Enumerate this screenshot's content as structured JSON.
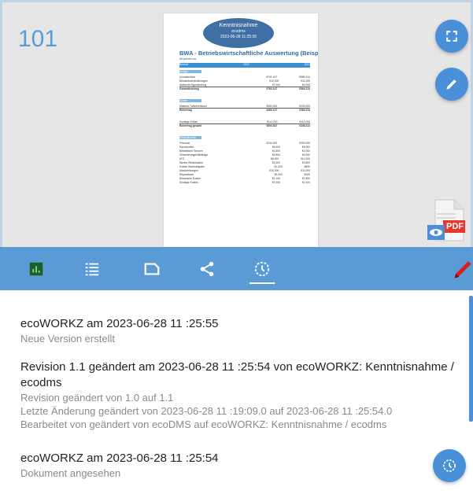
{
  "document": {
    "number": "101",
    "stamp": {
      "line1": "Kenntnisnahme",
      "line2": "ecodms",
      "line3": "2023-06-28 11:25:56"
    },
    "title": "BWA - Betriebswirtschaftliche Auswertung (Beispiel)",
    "subtitle": "Musterfirma",
    "header_row": {
      "label": "Bereich",
      "col1": "2022",
      "col2": "2021"
    },
    "rows": [
      {
        "label": "Erträge",
        "kind": "section"
      },
      {
        "label": "Umsatzerlöse",
        "v1": "€741.147",
        "v2": "€580.214",
        "kind": "row"
      },
      {
        "label": "Bestandsveränderungen",
        "v1": "€12.000",
        "v2": "€11.000",
        "kind": "row"
      },
      {
        "label": "Aktivierte Eigenleistung",
        "v1": "€7.000",
        "v2": "€4.000",
        "kind": "row"
      },
      {
        "label": "Gesamtleistung",
        "v1": "€760.147",
        "v2": "€594.214",
        "kind": "bold"
      },
      {
        "label": "Kosten",
        "kind": "section"
      },
      {
        "label": "Material / Wareneinkauf",
        "v1": "€280.000",
        "v2": "€230.000",
        "kind": "row"
      },
      {
        "label": "Rohertrag",
        "v1": "€480.147",
        "v2": "€364.214",
        "kind": "bold"
      },
      {
        "label": "Sonstige Erlöse",
        "v1": "€114.200",
        "v2": "€110.000",
        "kind": "row"
      },
      {
        "label": "Rohertrag gesamt",
        "v1": "€594.347",
        "v2": "€446.214",
        "kind": "bold"
      },
      {
        "label": "Gesamtkosten",
        "kind": "section"
      },
      {
        "label": "Personal",
        "v1": "€230.000",
        "v2": "€200.000",
        "kind": "row"
      },
      {
        "label": "Raumkosten",
        "v1": "€6.000",
        "v2": "€6.000",
        "kind": "row"
      },
      {
        "label": "Betriebliche Steuern",
        "v1": "€1.500",
        "v2": "€2.000",
        "kind": "row"
      },
      {
        "label": "Versicherungen/Beiträge",
        "v1": "€4.500",
        "v2": "€4.000",
        "kind": "row"
      },
      {
        "label": "KFZ",
        "v1": "€8.200",
        "v2": "€10.200",
        "kind": "row"
      },
      {
        "label": "Werbe-/Reisekosten",
        "v1": "€2.000",
        "v2": "€3.800",
        "kind": "row"
      },
      {
        "label": "Kosten Warenabgabe",
        "v1": "€1.200",
        "v2": "€800",
        "kind": "row"
      },
      {
        "label": "Abschreibungen",
        "v1": "€10.000",
        "v2": "€11.000",
        "kind": "row"
      },
      {
        "label": "Reparaturen",
        "v1": "€3.000",
        "v2": "€200",
        "kind": "row"
      },
      {
        "label": "Besondere Kosten",
        "v1": "€2.100",
        "v2": "€1.800",
        "kind": "row"
      },
      {
        "label": "Sonstige Kosten",
        "v1": "€3.100",
        "v2": "€2.100",
        "kind": "row"
      }
    ]
  },
  "fabs": {
    "expand": "fullscreen-icon",
    "edit": "pencil-icon",
    "history": "history-icon"
  },
  "pdf_badge": "PDF",
  "toolbar": {
    "items": [
      "stats-icon",
      "list-icon",
      "label-icon",
      "share-icon",
      "history-icon",
      "pen-icon"
    ],
    "active": "history-icon",
    "accent": "#5b9bd5"
  },
  "history": [
    {
      "title": "ecoWORKZ am 2023-06-28 11 :25:55",
      "details": [
        "Neue Version erstellt"
      ]
    },
    {
      "title": "Revision 1.1 geändert am 2023-06-28 11 :25:54 von ecoWORKZ: Kenntnisnahme / ecodms",
      "details": [
        "Revision geändert von 1.0 auf 1.1",
        "Letzte Änderung geändert von 2023-06-28 11 :19:09.0 auf 2023-06-28 11 :25:54.0",
        "Bearbeitet von geändert von ecoDMS auf ecoWORKZ: Kenntnisnahme / ecodms"
      ]
    },
    {
      "title": "ecoWORKZ am 2023-06-28 11 :25:54",
      "details": [
        "Dokument angesehen"
      ]
    }
  ]
}
